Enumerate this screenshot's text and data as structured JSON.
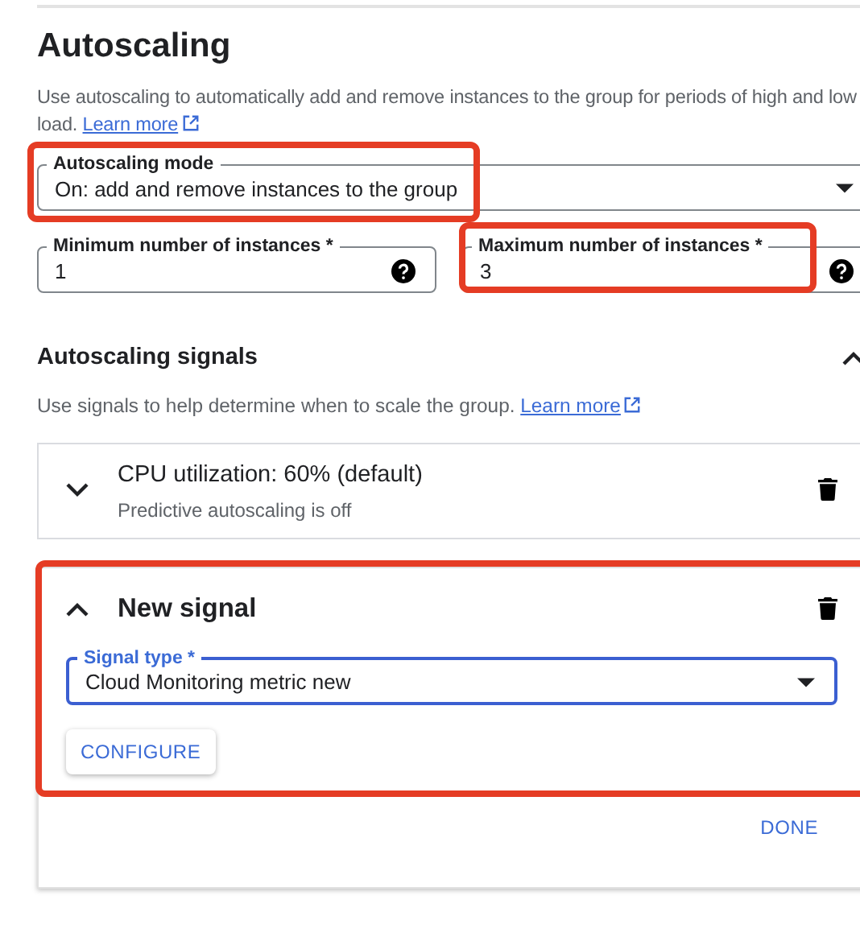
{
  "title": "Autoscaling",
  "description": "Use autoscaling to automatically add and remove instances to the group for periods of high and low load.",
  "learn_more": "Learn more",
  "mode_field": {
    "label": "Autoscaling mode",
    "value": "On: add and remove instances to the group",
    "highlighted": true
  },
  "instance_fields": [
    {
      "label": "Minimum number of instances *",
      "value": "1",
      "highlighted": false
    },
    {
      "label": "Maximum number of instances *",
      "value": "3",
      "highlighted": true
    }
  ],
  "signals_section": {
    "title": "Autoscaling signals",
    "expanded": true,
    "description": "Use signals to help determine when to scale the group.",
    "learn_more": "Learn more"
  },
  "signals": [
    {
      "title": "CPU utilization: 60% (default)",
      "subtitle": "Predictive autoscaling is off",
      "expanded": false,
      "highlighted": false
    },
    {
      "title": "New signal",
      "expanded": true,
      "highlighted": true,
      "signal_type": {
        "label": "Signal type *",
        "value": "Cloud Monitoring metric new"
      },
      "configure": "CONFIGURE",
      "done": "DONE"
    }
  ]
}
